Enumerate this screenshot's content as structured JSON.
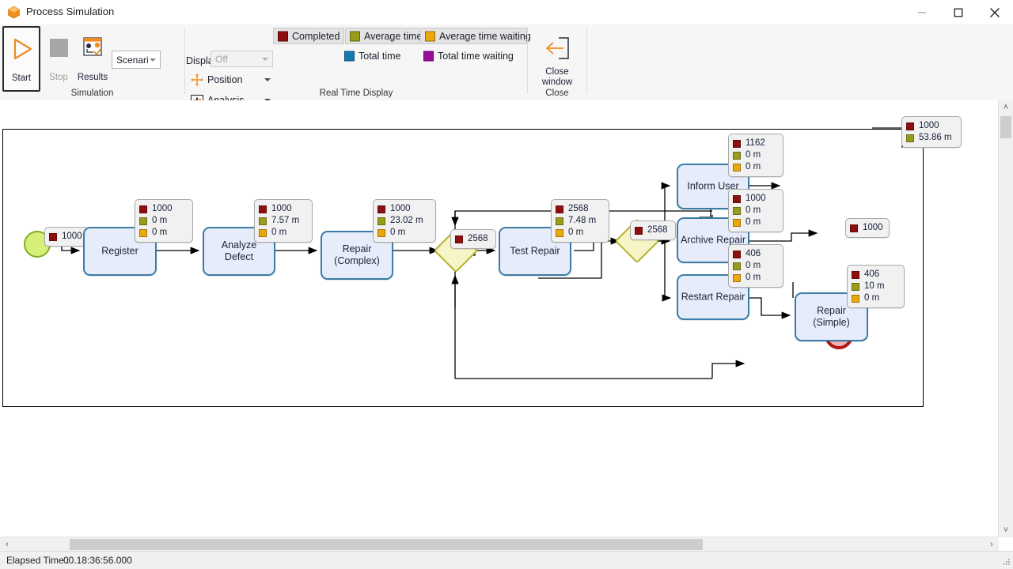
{
  "window": {
    "title": "Process Simulation",
    "app_icon": "package-icon",
    "minimize_label": "Minimize",
    "maximize_label": "Maximize",
    "close_label": "Close"
  },
  "ribbon": {
    "groups": [
      {
        "name": "simulation",
        "label": "Simulation"
      },
      {
        "name": "real-time-display",
        "label": "Real Time Display"
      },
      {
        "name": "close",
        "label": "Close"
      }
    ],
    "simulation": {
      "start": {
        "label": "Start",
        "icon": "play-icon",
        "selected": true,
        "enabled": true
      },
      "stop": {
        "label": "Stop",
        "icon": "stop-icon",
        "enabled": false
      },
      "results": {
        "label": "Results",
        "icon": "results-icon",
        "enabled": true
      },
      "scenario_combo": {
        "value": "Scenari",
        "enabled": true
      }
    },
    "real_time_display": {
      "display_label": "Display",
      "display_combo": {
        "value": "Off",
        "enabled": false
      },
      "position": {
        "label": "Position",
        "icon": "move-icon",
        "has_menu": true
      },
      "analysis": {
        "label": "Analysis",
        "icon": "bar-chart-icon",
        "has_menu": true
      },
      "legend": [
        {
          "name": "completed",
          "label": "Completed",
          "color": "#8e0f0f",
          "active": true
        },
        {
          "name": "average-time",
          "label": "Average time",
          "color": "#999c1a",
          "active": true
        },
        {
          "name": "average-time-waiting",
          "label": "Average time waiting",
          "color": "#eaa80c",
          "active": true
        },
        {
          "name": "total-time",
          "label": "Total time",
          "color": "#1679b0",
          "active": false
        },
        {
          "name": "total-time-waiting",
          "label": "Total time waiting",
          "color": "#9a0b9a",
          "active": false
        }
      ]
    },
    "close_window": {
      "label_line1": "Close",
      "label_line2": "window",
      "icon": "close-window-icon"
    }
  },
  "diagram": {
    "pool_tooltip": {
      "rows": [
        {
          "color": "#8e0f0f",
          "value": "1000"
        },
        {
          "color": "#999c1a",
          "value": "53.86 m"
        }
      ]
    },
    "events": [
      {
        "name": "start-event",
        "type": "start",
        "tooltip": [
          {
            "color": "#8e0f0f",
            "value": "1000"
          }
        ]
      },
      {
        "name": "end-event",
        "type": "end",
        "tooltip": [
          {
            "color": "#8e0f0f",
            "value": "1000"
          }
        ]
      }
    ],
    "gateways": [
      {
        "name": "gateway-1",
        "tooltip": [
          {
            "color": "#8e0f0f",
            "value": "2568"
          }
        ]
      },
      {
        "name": "gateway-2",
        "tooltip": [
          {
            "color": "#8e0f0f",
            "value": "2568"
          }
        ]
      }
    ],
    "tasks": [
      {
        "name": "task-register",
        "label": "Register",
        "tooltip": [
          {
            "color": "#8e0f0f",
            "value": "1000"
          },
          {
            "color": "#999c1a",
            "value": "0 m"
          },
          {
            "color": "#eaa80c",
            "value": "0 m"
          }
        ]
      },
      {
        "name": "task-analyze-defect",
        "label": "Analyze Defect",
        "tooltip": [
          {
            "color": "#8e0f0f",
            "value": "1000"
          },
          {
            "color": "#999c1a",
            "value": "7.57 m"
          },
          {
            "color": "#eaa80c",
            "value": "0 m"
          }
        ]
      },
      {
        "name": "task-repair-complex",
        "label": "Repair\n(Complex)",
        "tooltip": [
          {
            "color": "#8e0f0f",
            "value": "1000"
          },
          {
            "color": "#999c1a",
            "value": "23.02 m"
          },
          {
            "color": "#eaa80c",
            "value": "0 m"
          }
        ]
      },
      {
        "name": "task-test-repair",
        "label": "Test Repair",
        "tooltip": [
          {
            "color": "#8e0f0f",
            "value": "2568"
          },
          {
            "color": "#999c1a",
            "value": "7.48 m"
          },
          {
            "color": "#eaa80c",
            "value": "0 m"
          }
        ]
      },
      {
        "name": "task-inform-user",
        "label": "Inform User",
        "tooltip": [
          {
            "color": "#8e0f0f",
            "value": "1162"
          },
          {
            "color": "#999c1a",
            "value": "0 m"
          },
          {
            "color": "#eaa80c",
            "value": "0 m"
          }
        ]
      },
      {
        "name": "task-archive-repair",
        "label": "Archive Repair",
        "tooltip": [
          {
            "color": "#8e0f0f",
            "value": "1000"
          },
          {
            "color": "#999c1a",
            "value": "0 m"
          },
          {
            "color": "#eaa80c",
            "value": "0 m"
          }
        ]
      },
      {
        "name": "task-restart-repair",
        "label": "Restart Repair",
        "tooltip": [
          {
            "color": "#8e0f0f",
            "value": "406"
          },
          {
            "color": "#999c1a",
            "value": "0 m"
          },
          {
            "color": "#eaa80c",
            "value": "0 m"
          }
        ]
      },
      {
        "name": "task-repair-simple",
        "label": "Repair (Simple)",
        "tooltip": [
          {
            "color": "#8e0f0f",
            "value": "406"
          },
          {
            "color": "#999c1a",
            "value": "10 m"
          },
          {
            "color": "#eaa80c",
            "value": "0 m"
          }
        ]
      }
    ]
  },
  "status": {
    "elapsed_label": "Elapsed Time :",
    "elapsed_value": "00.18:36:56.000"
  },
  "scroll": {
    "left_arrow": "‹",
    "right_arrow": "›",
    "up_arrow": "˄",
    "down_arrow": "˅"
  }
}
